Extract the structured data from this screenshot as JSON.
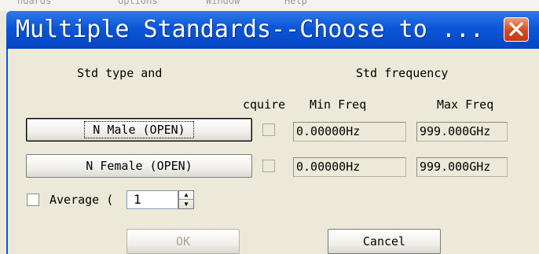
{
  "window": {
    "title": "Multiple Standards--Choose to ...",
    "titlebar_color": "#0a56d8",
    "close_color": "#d24a22",
    "close_icon": "close-icon"
  },
  "background_menu": [
    "ndards",
    "Options",
    "Window",
    "Help"
  ],
  "header": {
    "std_type": "Std type and",
    "std_frequency": "Std frequency",
    "acquire": "cquire",
    "min_freq": "Min Freq",
    "max_freq": "Max Freq"
  },
  "standards": [
    {
      "label": "N Male (OPEN)",
      "min": "0.00000Hz",
      "max": "999.000GHz",
      "focused": true
    },
    {
      "label": "N Female (OPEN)",
      "min": "0.00000Hz",
      "max": "999.000GHz",
      "focused": false
    }
  ],
  "average": {
    "label": "Average (",
    "value": "1"
  },
  "buttons": {
    "ok": "OK",
    "cancel": "Cancel"
  }
}
